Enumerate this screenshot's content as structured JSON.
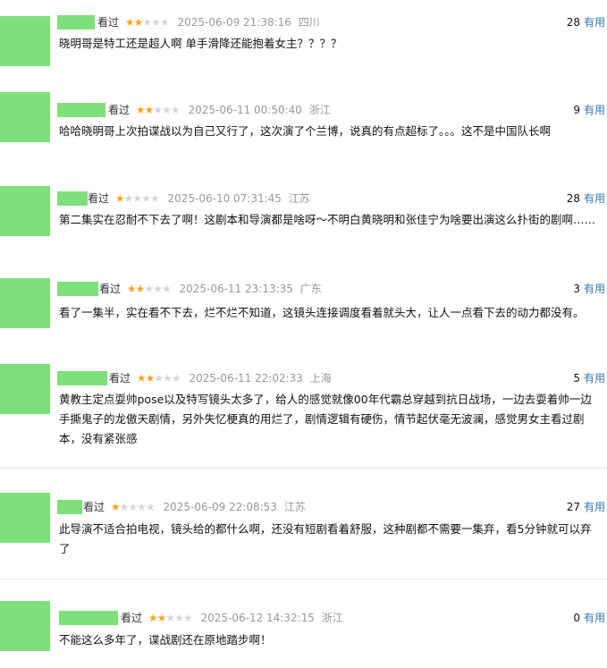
{
  "reviews": [
    {
      "watched": "看过",
      "stars_on": "★★",
      "stars_off": "★★★",
      "time": "2025-06-09 21:38:16",
      "location": "四川",
      "useful_count": "28",
      "useful_label": "有用",
      "text": "晓明哥是特工还是超人啊 单手滑降还能抱着女主？？？？"
    },
    {
      "watched": "看过",
      "stars_on": "★★",
      "stars_off": "★★★",
      "time": "2025-06-11 00:50:40",
      "location": "浙江",
      "useful_count": "9",
      "useful_label": "有用",
      "text": "哈哈晓明哥上次拍谍战以为自己又行了，这次演了个兰博，说真的有点超标了。。。这不是中国队长啊"
    },
    {
      "watched": "看过",
      "stars_on": "★",
      "stars_off": "★★★★",
      "time": "2025-06-10 07:31:45",
      "location": "江苏",
      "useful_count": "28",
      "useful_label": "有用",
      "text": "第二集实在忍耐不下去了啊！这剧本和导演都是啥呀～不明白黄晓明和张佳宁为啥要出演这么扑街的剧啊……"
    },
    {
      "watched": "看过",
      "stars_on": "★★",
      "stars_off": "★★★",
      "time": "2025-06-11 23:13:35",
      "location": "广东",
      "useful_count": "3",
      "useful_label": "有用",
      "text": "看了一集半，实在看不下去，烂不烂不知道，这镜头连接调度看着就头大，让人一点看下去的动力都没有。"
    },
    {
      "watched": "看过",
      "stars_on": "★★",
      "stars_off": "★★★",
      "time": "2025-06-11 22:02:33",
      "location": "上海",
      "useful_count": "5",
      "useful_label": "有用",
      "text": "黄教主定点耍帅pose以及特写镜头太多了，给人的感觉就像00年代霸总穿越到抗日战场，一边去耍着帅一边手撕鬼子的龙傲天剧情，另外失忆梗真的用烂了，剧情逻辑有硬伤，情节起伏毫无波澜，感觉男女主看过剧本，没有紧张感"
    },
    {
      "watched": "看过",
      "stars_on": "★",
      "stars_off": "★★★★",
      "time": "2025-06-09 22:08:53",
      "location": "江苏",
      "useful_count": "27",
      "useful_label": "有用",
      "text": "此导演不适合拍电视，镜头给的都什么啊，还没有短剧看着舒服，这种剧都不需要一集弃，看5分钟就可以弃了"
    },
    {
      "watched": "看过",
      "stars_on": "★★",
      "stars_off": "★★★",
      "time": "2025-06-12 14:32:15",
      "location": "浙江",
      "useful_count": "0",
      "useful_label": "有用",
      "text": "不能这么多年了，谍战剧还在原地踏步啊！"
    }
  ]
}
